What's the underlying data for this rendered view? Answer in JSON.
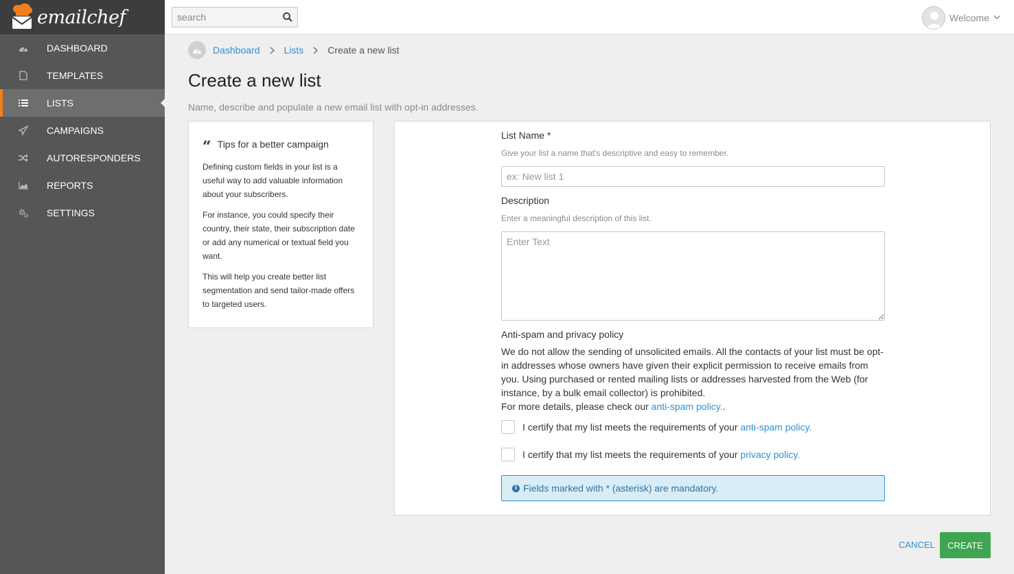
{
  "brand": {
    "name": "emailchef",
    "accent": "#f07f1b"
  },
  "search": {
    "placeholder": "search"
  },
  "user": {
    "welcome": "Welcome"
  },
  "sidebar": {
    "items": [
      {
        "label": "DASHBOARD",
        "icon": "dashboard-icon"
      },
      {
        "label": "TEMPLATES",
        "icon": "file-icon"
      },
      {
        "label": "LISTS",
        "icon": "list-icon",
        "active": true
      },
      {
        "label": "CAMPAIGNS",
        "icon": "paper-plane-icon"
      },
      {
        "label": "AUTORESPONDERS",
        "icon": "shuffle-icon"
      },
      {
        "label": "REPORTS",
        "icon": "area-chart-icon"
      },
      {
        "label": "SETTINGS",
        "icon": "gears-icon"
      }
    ]
  },
  "breadcrumb": {
    "dashboard": "Dashboard",
    "lists": "Lists",
    "current": "Create a new list"
  },
  "page": {
    "title": "Create a new list",
    "subtitle": "Name, describe and populate a new email list with opt-in addresses."
  },
  "tips": {
    "title": "Tips for a better campaign",
    "p1": "Defining custom fields in your list is a useful way to add valuable information about your subscribers.",
    "p2": "For instance, you could specify their country, their state, their subscription date or add any numerical or textual field you want.",
    "p3": "This will help you create better list segmentation and send tailor-made offers to targeted users."
  },
  "form": {
    "list_name_label": "List Name *",
    "list_name_help": "Give your list a name that's descriptive and easy to remember.",
    "list_name_placeholder": "ex: New list 1",
    "description_label": "Description",
    "description_help": "Enter a meaningful description of this list.",
    "description_placeholder": "Enter Text",
    "policy_title": "Anti-spam and privacy policy",
    "policy_text": "We do not allow the sending of unsolicited emails. All the contacts of your list must be opt-in addresses whose owners have given their explicit permission to receive emails from you. Using purchased or rented mailing lists or addresses harvested from the Web (for instance, by a bulk email collector) is prohibited.",
    "policy_more_prefix": "For more details, please check our ",
    "policy_more_link": "anti-spam policy.",
    "policy_more_suffix": ".",
    "cert1_prefix": "I certify that my list meets the requirements of your ",
    "cert1_link": "anti-spam policy.",
    "cert2_prefix": "I certify that my list meets the requirements of your ",
    "cert2_link": "privacy policy.",
    "mandatory_note": "Fields marked with * (asterisk) are mandatory."
  },
  "actions": {
    "cancel": "CANCEL",
    "create": "CREATE"
  }
}
